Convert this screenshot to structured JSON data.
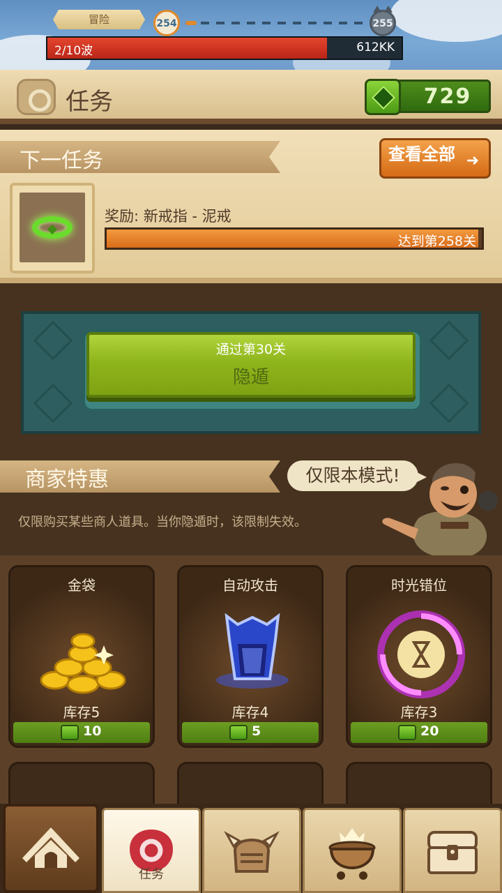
{
  "hud": {
    "mode_label": "冒险",
    "current_level": "254",
    "next_level": "255",
    "wave_text": "2/10波",
    "wave_progress": 0.79,
    "enemy_hp": "612KK"
  },
  "header": {
    "title": "任务",
    "gem_count": "729"
  },
  "next_mission": {
    "section_title": "下一任务",
    "view_all_label": "查看全部",
    "reward_text": "奖励: 新戒指 - 泥戒",
    "target_text": "达到第258关",
    "progress": 0.99
  },
  "hide_button": {
    "subtitle": "通过第30关",
    "label": "隐遁"
  },
  "merchant": {
    "section_title": "商家特惠",
    "bubble_text": "仅限本模式!",
    "description": "仅限购买某些商人道具。当你隐遁时，该限制失效。"
  },
  "shop": {
    "items": [
      {
        "name": "金袋",
        "stock": "库存5",
        "price": "10",
        "icon": "gold-coins-icon"
      },
      {
        "name": "自动攻击",
        "stock": "库存4",
        "price": "5",
        "icon": "auto-attack-helm-icon"
      },
      {
        "name": "时光错位",
        "stock": "库存3",
        "price": "20",
        "icon": "time-vortex-icon"
      }
    ]
  },
  "nav": {
    "tabs": [
      {
        "icon": "camp-tent-icon"
      },
      {
        "icon": "mission-seal-icon",
        "label": "任务",
        "active": true
      },
      {
        "icon": "knight-helmet-icon"
      },
      {
        "icon": "cauldron-icon"
      },
      {
        "icon": "treasure-chest-icon"
      }
    ]
  },
  "colors": {
    "accent_orange": "#d96c1b",
    "gem_green": "#4f8d1c",
    "wave_red": "#e4462e",
    "panel_teal": "#2e5e5f"
  }
}
